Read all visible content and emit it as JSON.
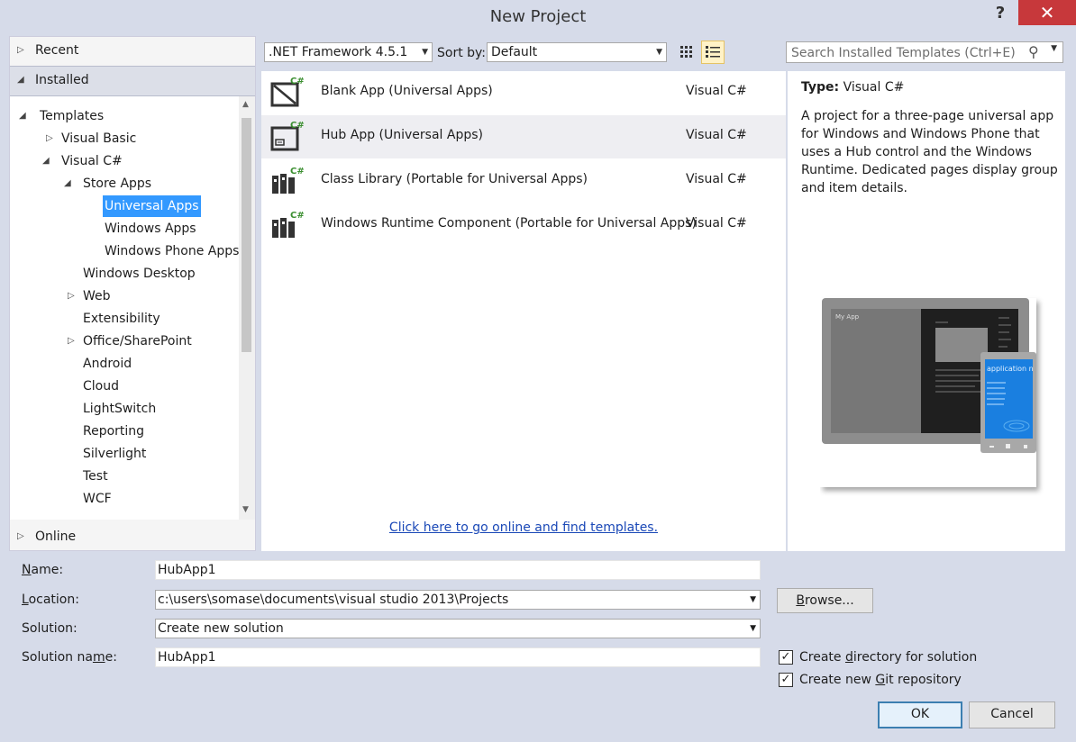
{
  "window": {
    "title": "New Project",
    "help": "?",
    "close": "✕"
  },
  "left": {
    "recent": "Recent",
    "installed": "Installed",
    "online": "Online",
    "tree": [
      {
        "label": "Templates",
        "expander": "◢"
      },
      {
        "label": "Visual Basic",
        "expander": "▷"
      },
      {
        "label": "Visual C#",
        "expander": "◢"
      },
      {
        "label": "Store Apps",
        "expander": "◢"
      },
      {
        "label": "Universal Apps",
        "expander": ""
      },
      {
        "label": "Windows Apps",
        "expander": ""
      },
      {
        "label": "Windows Phone Apps",
        "expander": ""
      },
      {
        "label": "Windows Desktop",
        "expander": ""
      },
      {
        "label": "Web",
        "expander": "▷"
      },
      {
        "label": "Extensibility",
        "expander": ""
      },
      {
        "label": "Office/SharePoint",
        "expander": "▷"
      },
      {
        "label": "Android",
        "expander": ""
      },
      {
        "label": "Cloud",
        "expander": ""
      },
      {
        "label": "LightSwitch",
        "expander": ""
      },
      {
        "label": "Reporting",
        "expander": ""
      },
      {
        "label": "Silverlight",
        "expander": ""
      },
      {
        "label": "Test",
        "expander": ""
      },
      {
        "label": "WCF",
        "expander": ""
      }
    ]
  },
  "toolbar": {
    "framework": ".NET Framework 4.5.1",
    "sort_label": "Sort by:",
    "sort_value": "Default",
    "search_placeholder": "Search Installed Templates (Ctrl+E)"
  },
  "templates": [
    {
      "name": "Blank App (Universal Apps)",
      "lang": "Visual C#",
      "badge": "C#"
    },
    {
      "name": "Hub App (Universal Apps)",
      "lang": "Visual C#",
      "badge": "C#"
    },
    {
      "name": "Class Library (Portable for Universal Apps)",
      "lang": "Visual C#",
      "badge": "C#"
    },
    {
      "name": "Windows Runtime Component (Portable for Universal Apps)",
      "lang": "Visual C#",
      "badge": "C#"
    }
  ],
  "online_link": "Click here to go online and find templates.",
  "details": {
    "type_label": "Type:",
    "type_value": "Visual C#",
    "description": "A project for a three-page universal app for Windows and Windows Phone that uses a Hub control and the Windows Runtime. Dedicated pages display group and item details.",
    "preview_app_title": "My App",
    "preview_phone_title": "application n"
  },
  "form": {
    "name_label_pre": "",
    "name_label_key": "N",
    "name_label_post": "ame:",
    "name_value": "HubApp1",
    "location_label_pre": "",
    "location_label_key": "L",
    "location_label_post": "ocation:",
    "location_value": "c:\\users\\somase\\documents\\visual studio 2013\\Projects",
    "browse_pre": "",
    "browse_key": "B",
    "browse_post": "rowse...",
    "solution_label": "Solution:",
    "solution_value": "Create new solution",
    "solution_name_pre": "Solution na",
    "solution_name_key": "m",
    "solution_name_post": "e:",
    "solution_name_value": "HubApp1",
    "create_dir_pre": "Create ",
    "create_dir_key": "d",
    "create_dir_post": "irectory for solution",
    "create_git_pre": "Create new ",
    "create_git_key": "G",
    "create_git_post": "it repository",
    "ok": "OK",
    "cancel": "Cancel"
  }
}
